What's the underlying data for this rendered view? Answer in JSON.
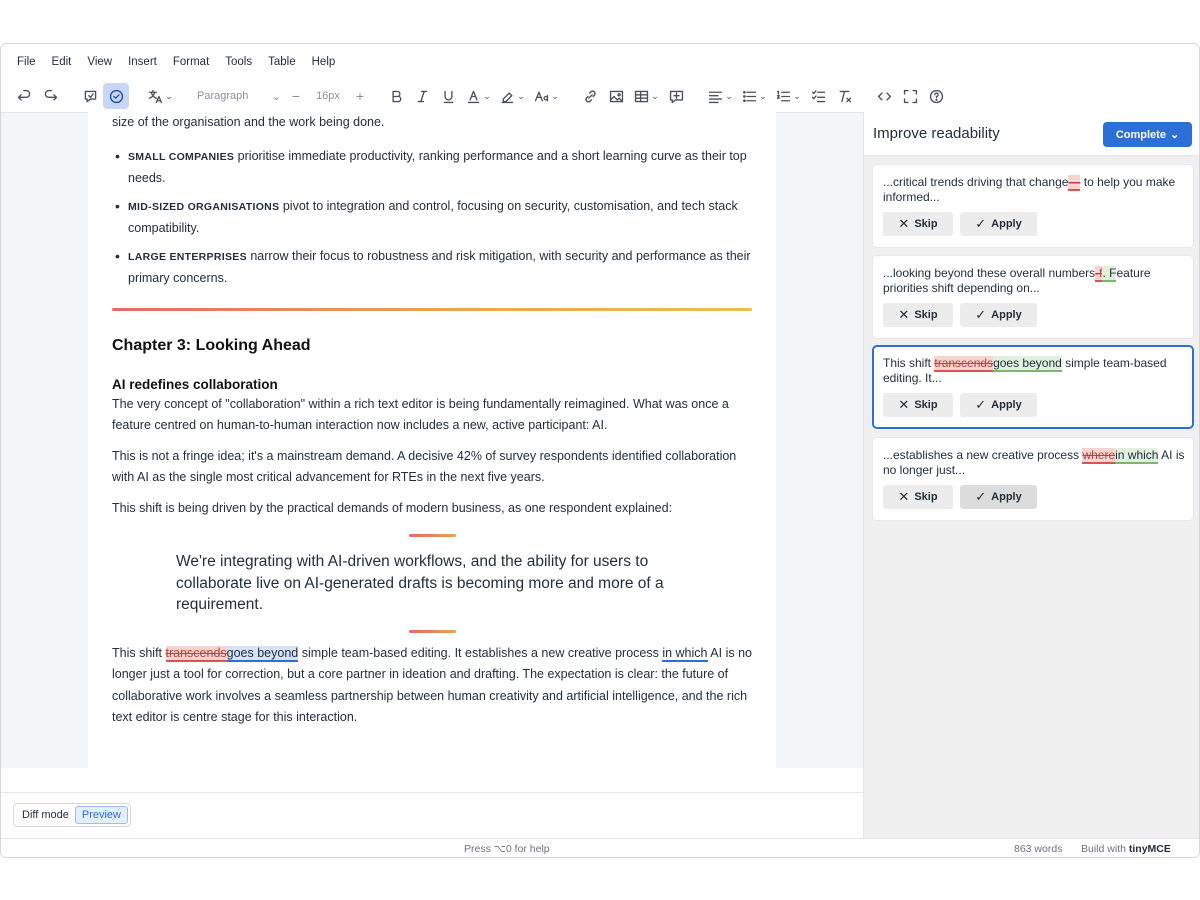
{
  "menubar": [
    "File",
    "Edit",
    "View",
    "Insert",
    "Format",
    "Tools",
    "Table",
    "Help"
  ],
  "toolbar": {
    "blocks_value": "Paragraph",
    "font_size": "16px"
  },
  "document": {
    "intro": "size of the organisation and the work being done.",
    "bullets": [
      {
        "label": "SMALL COMPANIES",
        "text": " prioritise immediate productivity, ranking performance and a short learning curve as their top needs."
      },
      {
        "label": "MID-SIZED ORGANISATIONS",
        "text": " pivot to integration and control, focusing on security, customisation, and tech stack compatibility."
      },
      {
        "label": "LARGE ENTERPRISES",
        "text": " narrow their focus to robustness and risk mitigation, with security and performance as their primary concerns."
      }
    ],
    "chapter_title": "Chapter 3: Looking Ahead",
    "section_title": "AI redefines collaboration",
    "para1": "The very concept of \"collaboration\" within a rich text editor is being fundamentally reimagined. What was once a feature centred on human-to-human interaction now includes a new, active participant: AI.",
    "para2": "This is not a fringe idea; it's a mainstream demand. A decisive 42% of survey respondents identified collaboration with AI as the single most critical advancement for RTEs in the next five years.",
    "para3": "This shift is being driven by the practical demands of modern business, as one respondent explained:",
    "quote": "We're integrating with AI-driven workflows, and the ability for users to collaborate live on AI-generated drafts is becoming more and more of a requirement.",
    "final": {
      "a": "This shift ",
      "del": "transcends",
      "ins": "goes beyond",
      "b": " simple team-based editing. It establishes a new creative process ",
      "ul": "in which",
      "c": " AI is no longer just a tool for correction, but a core partner in ideation and drafting. The expectation is clear: the future of collaborative work involves a seamless partnership between human creativity and artificial intelligence, and the rich text editor is centre stage for this interaction."
    }
  },
  "diffbar": {
    "mode_label": "Diff mode",
    "preview_label": "Preview"
  },
  "status": {
    "help": "Press ⌥0 for help",
    "words": "863 words",
    "build": "Build with",
    "brand": "tinyMCE"
  },
  "sidebar": {
    "title": "Improve readability",
    "complete_label": "Complete",
    "skip_label": "Skip",
    "apply_label": "Apply",
    "cards": [
      {
        "pre": "...critical trends driving that change",
        "del": "—",
        "ins": "",
        "post": " to help you make informed..."
      },
      {
        "pre": "...looking beyond these overall numbers",
        "del": "-f",
        "ins": ". F",
        "post": "eature priorities shift depending on..."
      },
      {
        "pre": "This shift ",
        "del": "transcends",
        "ins": "goes beyond",
        "post": " simple team-based editing. It..."
      },
      {
        "pre": "...establishes a new creative process ",
        "del": "where",
        "ins": "in which",
        "post": " AI is no longer just..."
      }
    ]
  }
}
